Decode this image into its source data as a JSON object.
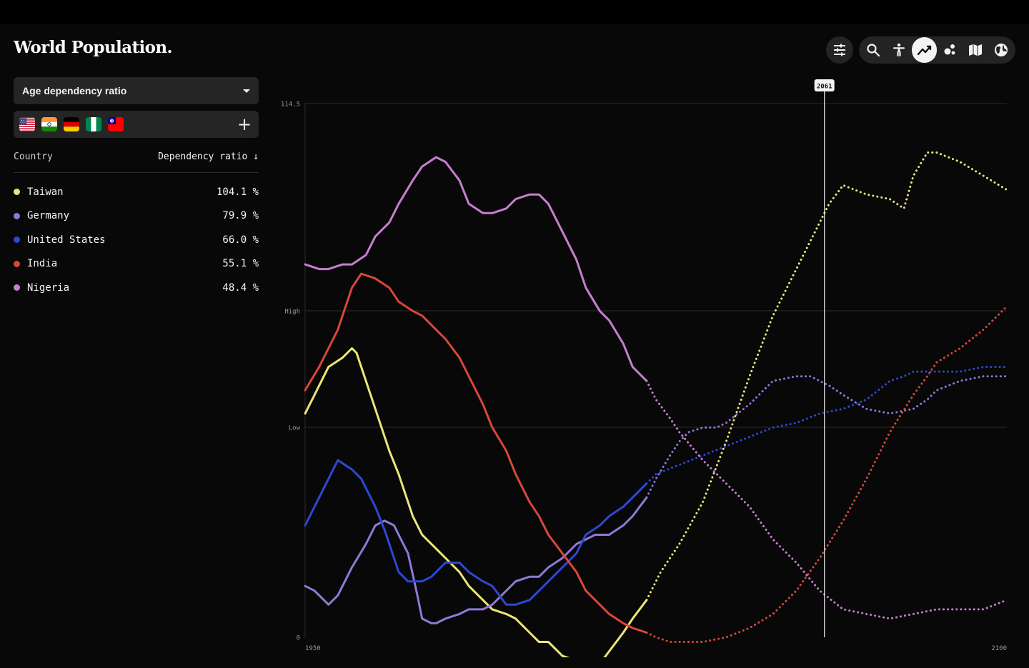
{
  "app": {
    "title": "World Population."
  },
  "indicator_select": {
    "selected": "Age dependency ratio"
  },
  "flags": [
    {
      "country": "United States",
      "icon": "flag-us-icon"
    },
    {
      "country": "India",
      "icon": "flag-india-icon"
    },
    {
      "country": "Germany",
      "icon": "flag-germany-icon"
    },
    {
      "country": "Nigeria",
      "icon": "flag-nigeria-icon"
    },
    {
      "country": "Taiwan",
      "icon": "flag-taiwan-icon"
    }
  ],
  "add_label": "+",
  "table": {
    "col_country": "Country",
    "col_value": "Dependency ratio ↓",
    "rows": [
      {
        "name": "Taiwan",
        "value": "104.1 %",
        "color": "#ece57a"
      },
      {
        "name": "Germany",
        "value": "79.9 %",
        "color": "#8f79d6"
      },
      {
        "name": "United States",
        "value": "66.0 %",
        "color": "#2f48d0"
      },
      {
        "name": "India",
        "value": "55.1 %",
        "color": "#d9473a"
      },
      {
        "name": "Nigeria",
        "value": "48.4 %",
        "color": "#c77ed0"
      }
    ]
  },
  "toolbar": {
    "icons": [
      "filter-sliders-icon",
      "search-icon",
      "accessibility-icon",
      "line-chart-icon",
      "bubble-chart-icon",
      "map-icon",
      "globe-icon"
    ],
    "active": "line-chart-icon"
  },
  "chart_data": {
    "type": "line",
    "x_range": [
      1950,
      2100
    ],
    "x_tick_labels": [
      "1950",
      "2100"
    ],
    "y_tick_labels": [
      "0",
      "Low",
      "High",
      "114.5"
    ],
    "y_max_label_value": 114.5,
    "projection_start": 2023,
    "cursor": {
      "year": 2061,
      "label": "2061"
    },
    "series": [
      {
        "name": "Taiwan",
        "color": "#ece57a",
        "x": [
          1950,
          1952,
          1955,
          1958,
          1960,
          1961,
          1963,
          1965,
          1968,
          1970,
          1973,
          1975,
          1978,
          1980,
          1983,
          1985,
          1988,
          1990,
          1993,
          1995,
          1998,
          2000,
          2002,
          2005,
          2008,
          2010,
          2012,
          2015,
          2018,
          2020,
          2023,
          2026,
          2030,
          2035,
          2040,
          2045,
          2050,
          2055,
          2058,
          2060,
          2062,
          2065,
          2070,
          2075,
          2078,
          2080,
          2083,
          2085,
          2090,
          2095,
          2100
        ],
        "y": [
          48,
          52,
          58,
          60,
          62,
          61,
          55,
          49,
          40,
          35,
          26,
          22,
          19,
          17,
          14,
          11,
          8,
          6,
          5,
          4,
          1,
          -1,
          -1,
          -4,
          -5,
          -7,
          -7,
          -3,
          1,
          4,
          8,
          14,
          20,
          29,
          42,
          56,
          69,
          79,
          85,
          89,
          93,
          97,
          95,
          94,
          92,
          99,
          104,
          104,
          102,
          99,
          96
        ]
      },
      {
        "name": "Germany",
        "color": "#8f79d6",
        "x": [
          1950,
          1952,
          1955,
          1957,
          1960,
          1963,
          1965,
          1967,
          1969,
          1970,
          1972,
          1974,
          1975,
          1977,
          1978,
          1980,
          1983,
          1985,
          1988,
          1990,
          1993,
          1995,
          1998,
          2000,
          2002,
          2005,
          2008,
          2010,
          2012,
          2015,
          2018,
          2020,
          2023,
          2025,
          2028,
          2030,
          2032,
          2035,
          2038,
          2040,
          2045,
          2050,
          2055,
          2058,
          2060,
          2062,
          2065,
          2070,
          2075,
          2080,
          2083,
          2085,
          2090,
          2095,
          2100
        ],
        "y": [
          11,
          10,
          7,
          9,
          15,
          20,
          24,
          25,
          24,
          22,
          18,
          9,
          4,
          3,
          3,
          4,
          5,
          6,
          6,
          7,
          10,
          12,
          13,
          13,
          15,
          17,
          20,
          21,
          22,
          22,
          24,
          26,
          30,
          34,
          39,
          42,
          44,
          45,
          45,
          46,
          50,
          55,
          56,
          56,
          55,
          54,
          52,
          49,
          48,
          49,
          51,
          53,
          55,
          56,
          56
        ]
      },
      {
        "name": "United States",
        "color": "#2f48d0",
        "x": [
          1950,
          1953,
          1955,
          1957,
          1960,
          1962,
          1965,
          1967,
          1970,
          1972,
          1974,
          1975,
          1977,
          1980,
          1983,
          1985,
          1988,
          1990,
          1993,
          1995,
          1998,
          2000,
          2003,
          2005,
          2008,
          2010,
          2013,
          2015,
          2018,
          2020,
          2023,
          2025,
          2030,
          2035,
          2040,
          2045,
          2050,
          2055,
          2060,
          2065,
          2070,
          2075,
          2078,
          2080,
          2085,
          2090,
          2095,
          2100
        ],
        "y": [
          24,
          30,
          34,
          38,
          36,
          34,
          28,
          23,
          14,
          12,
          12,
          12,
          13,
          16,
          16,
          14,
          12,
          11,
          7,
          7,
          8,
          10,
          13,
          15,
          18,
          22,
          24,
          26,
          28,
          30,
          33,
          35,
          37,
          39,
          41,
          43,
          45,
          46,
          48,
          49,
          51,
          55,
          56,
          57,
          57,
          57,
          58,
          58
        ]
      },
      {
        "name": "India",
        "color": "#d9473a",
        "x": [
          1950,
          1953,
          1955,
          1957,
          1960,
          1962,
          1965,
          1968,
          1970,
          1973,
          1975,
          1978,
          1980,
          1983,
          1985,
          1988,
          1990,
          1993,
          1995,
          1998,
          2000,
          2002,
          2005,
          2008,
          2010,
          2013,
          2015,
          2018,
          2020,
          2023,
          2025,
          2028,
          2030,
          2035,
          2040,
          2045,
          2050,
          2055,
          2060,
          2065,
          2070,
          2075,
          2080,
          2083,
          2085,
          2090,
          2095,
          2100
        ],
        "y": [
          53,
          58,
          62,
          66,
          75,
          78,
          77,
          75,
          72,
          70,
          69,
          66,
          64,
          60,
          56,
          50,
          45,
          40,
          35,
          29,
          26,
          22,
          18,
          14,
          10,
          7,
          5,
          3,
          2,
          1,
          0,
          -1,
          -1,
          -1,
          0,
          2,
          5,
          10,
          17,
          25,
          34,
          44,
          52,
          56,
          59,
          62,
          66,
          71
        ]
      },
      {
        "name": "Nigeria",
        "color": "#c77ed0",
        "x": [
          1950,
          1953,
          1955,
          1958,
          1960,
          1963,
          1965,
          1968,
          1970,
          1973,
          1975,
          1978,
          1980,
          1983,
          1985,
          1988,
          1990,
          1993,
          1995,
          1998,
          2000,
          2002,
          2005,
          2008,
          2010,
          2013,
          2015,
          2018,
          2020,
          2023,
          2025,
          2028,
          2030,
          2035,
          2040,
          2045,
          2050,
          2055,
          2060,
          2065,
          2070,
          2075,
          2080,
          2085,
          2090,
          2095,
          2100
        ],
        "y": [
          80,
          79,
          79,
          80,
          80,
          82,
          86,
          89,
          93,
          98,
          101,
          103,
          102,
          98,
          93,
          91,
          91,
          92,
          94,
          95,
          95,
          93,
          87,
          81,
          75,
          70,
          68,
          63,
          58,
          55,
          51,
          47,
          44,
          38,
          33,
          28,
          21,
          16,
          10,
          6,
          5,
          4,
          5,
          6,
          6,
          6,
          8
        ]
      }
    ]
  }
}
